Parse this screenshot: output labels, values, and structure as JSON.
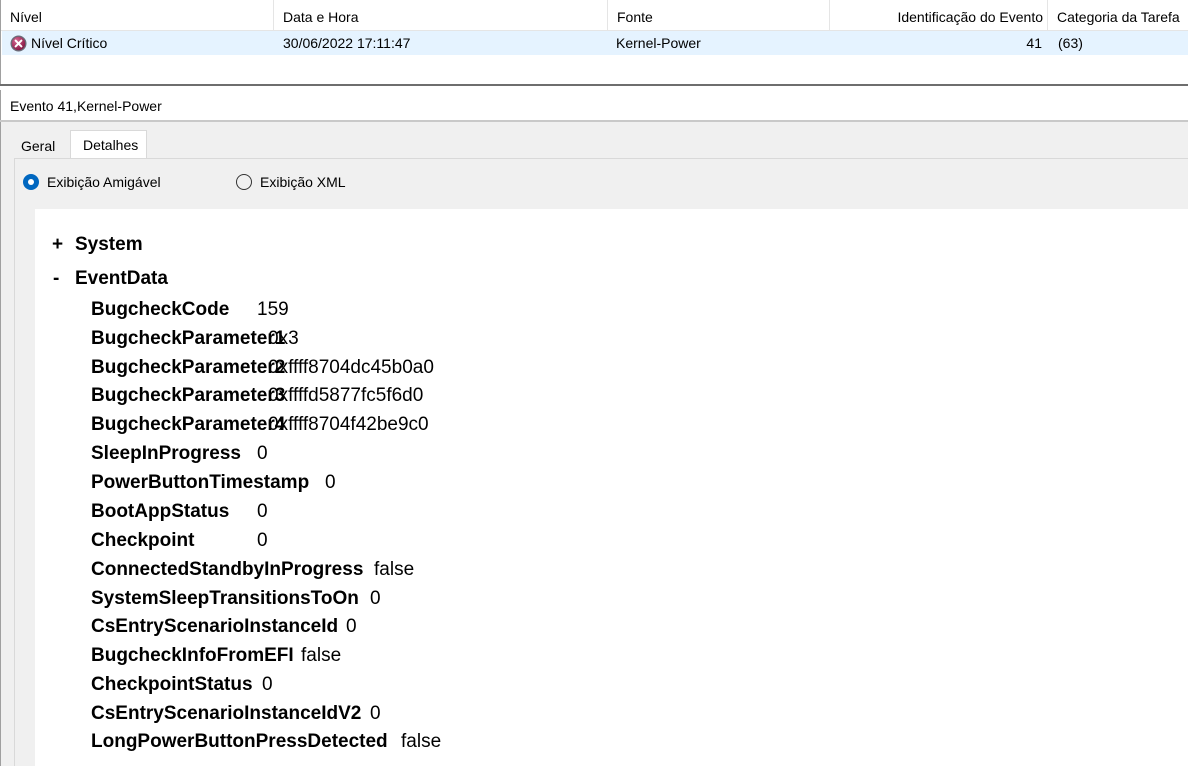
{
  "grid": {
    "columns": [
      "Nível",
      "Data e Hora",
      "Fonte",
      "Identificação do Evento",
      "Categoria da Tarefa"
    ],
    "row": {
      "level_icon": "critical-error-icon",
      "level": "Nível Crítico",
      "datetime": "30/06/2022 17:11:47",
      "source": "Kernel-Power",
      "event_id": "41",
      "task_category": "(63)"
    }
  },
  "panel": {
    "title": "Evento 41,Kernel-Power",
    "tabs": [
      "Geral",
      "Detalhes"
    ],
    "active_tab": "Detalhes",
    "view_options": [
      "Exibição Amigável",
      "Exibição XML"
    ],
    "selected_view": "Exibição Amigável"
  },
  "details": {
    "system": {
      "sign": "+",
      "label": "System"
    },
    "eventdata": {
      "sign": "-",
      "label": "EventData"
    },
    "properties": [
      {
        "key": "BugcheckCode",
        "value": "159"
      },
      {
        "key": "BugcheckParameter1",
        "value": "0x3"
      },
      {
        "key": "BugcheckParameter2",
        "value": "0xffff8704dc45b0a0"
      },
      {
        "key": "BugcheckParameter3",
        "value": "0xffffd5877fc5f6d0"
      },
      {
        "key": "BugcheckParameter4",
        "value": "0xffff8704f42be9c0"
      },
      {
        "key": "SleepInProgress",
        "value": "0"
      },
      {
        "key": "PowerButtonTimestamp",
        "value": "0"
      },
      {
        "key": "BootAppStatus",
        "value": "0"
      },
      {
        "key": "Checkpoint",
        "value": "0"
      },
      {
        "key": "ConnectedStandbyInProgress",
        "value": "false"
      },
      {
        "key": "SystemSleepTransitionsToOn",
        "value": "0"
      },
      {
        "key": "CsEntryScenarioInstanceId",
        "value": "0"
      },
      {
        "key": "BugcheckInfoFromEFI",
        "value": "false"
      },
      {
        "key": "CheckpointStatus",
        "value": "0"
      },
      {
        "key": "CsEntryScenarioInstanceIdV2",
        "value": "0"
      },
      {
        "key": "LongPowerButtonPressDetected",
        "value": "false"
      }
    ]
  },
  "colors": {
    "selected_row": "#e5f3ff",
    "radio_accent": "#0067c0",
    "panel_background": "#f0f0f0"
  }
}
